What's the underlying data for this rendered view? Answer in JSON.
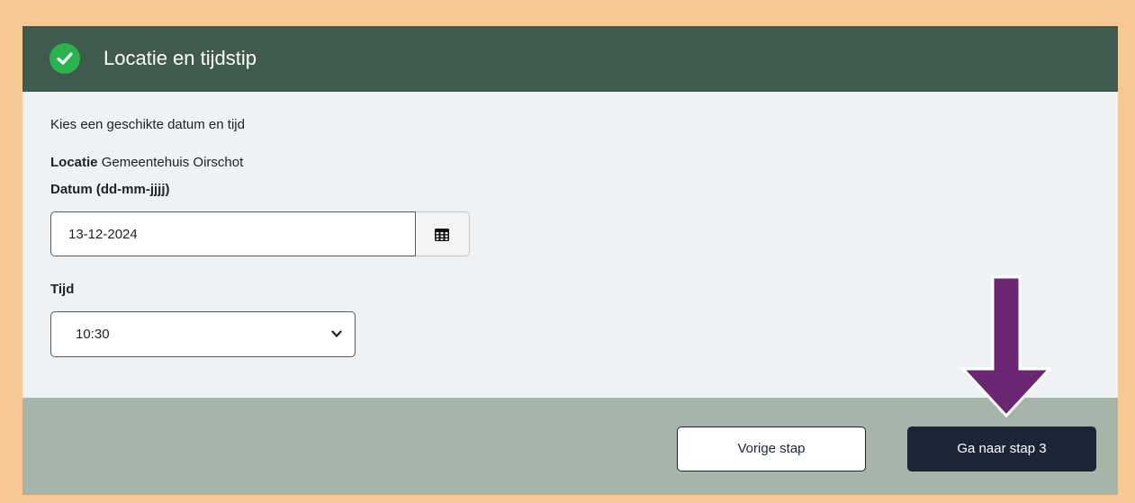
{
  "step": {
    "title": "Locatie en tijdstip",
    "status_icon": "check-circle-icon"
  },
  "intro": "Kies een geschikte datum en tijd",
  "location": {
    "label": "Locatie",
    "value": "Gemeentehuis Oirschot"
  },
  "date": {
    "label": "Datum (dd-mm-jjjj)",
    "value": "13-12-2024",
    "button_icon": "calendar-icon"
  },
  "time": {
    "label": "Tijd",
    "value": "10:30"
  },
  "footer": {
    "prev_label": "Vorige stap",
    "next_label": "Ga naar stap 3"
  },
  "annotation": {
    "icon": "arrow-down-icon"
  },
  "colors": {
    "header_bg": "#3e5b4e",
    "success_green": "#2cb24d",
    "footer_bg": "#a6b4aa",
    "primary_button": "#1c2538",
    "annotation_arrow": "#6a2670",
    "page_frame": "#f5c894"
  }
}
